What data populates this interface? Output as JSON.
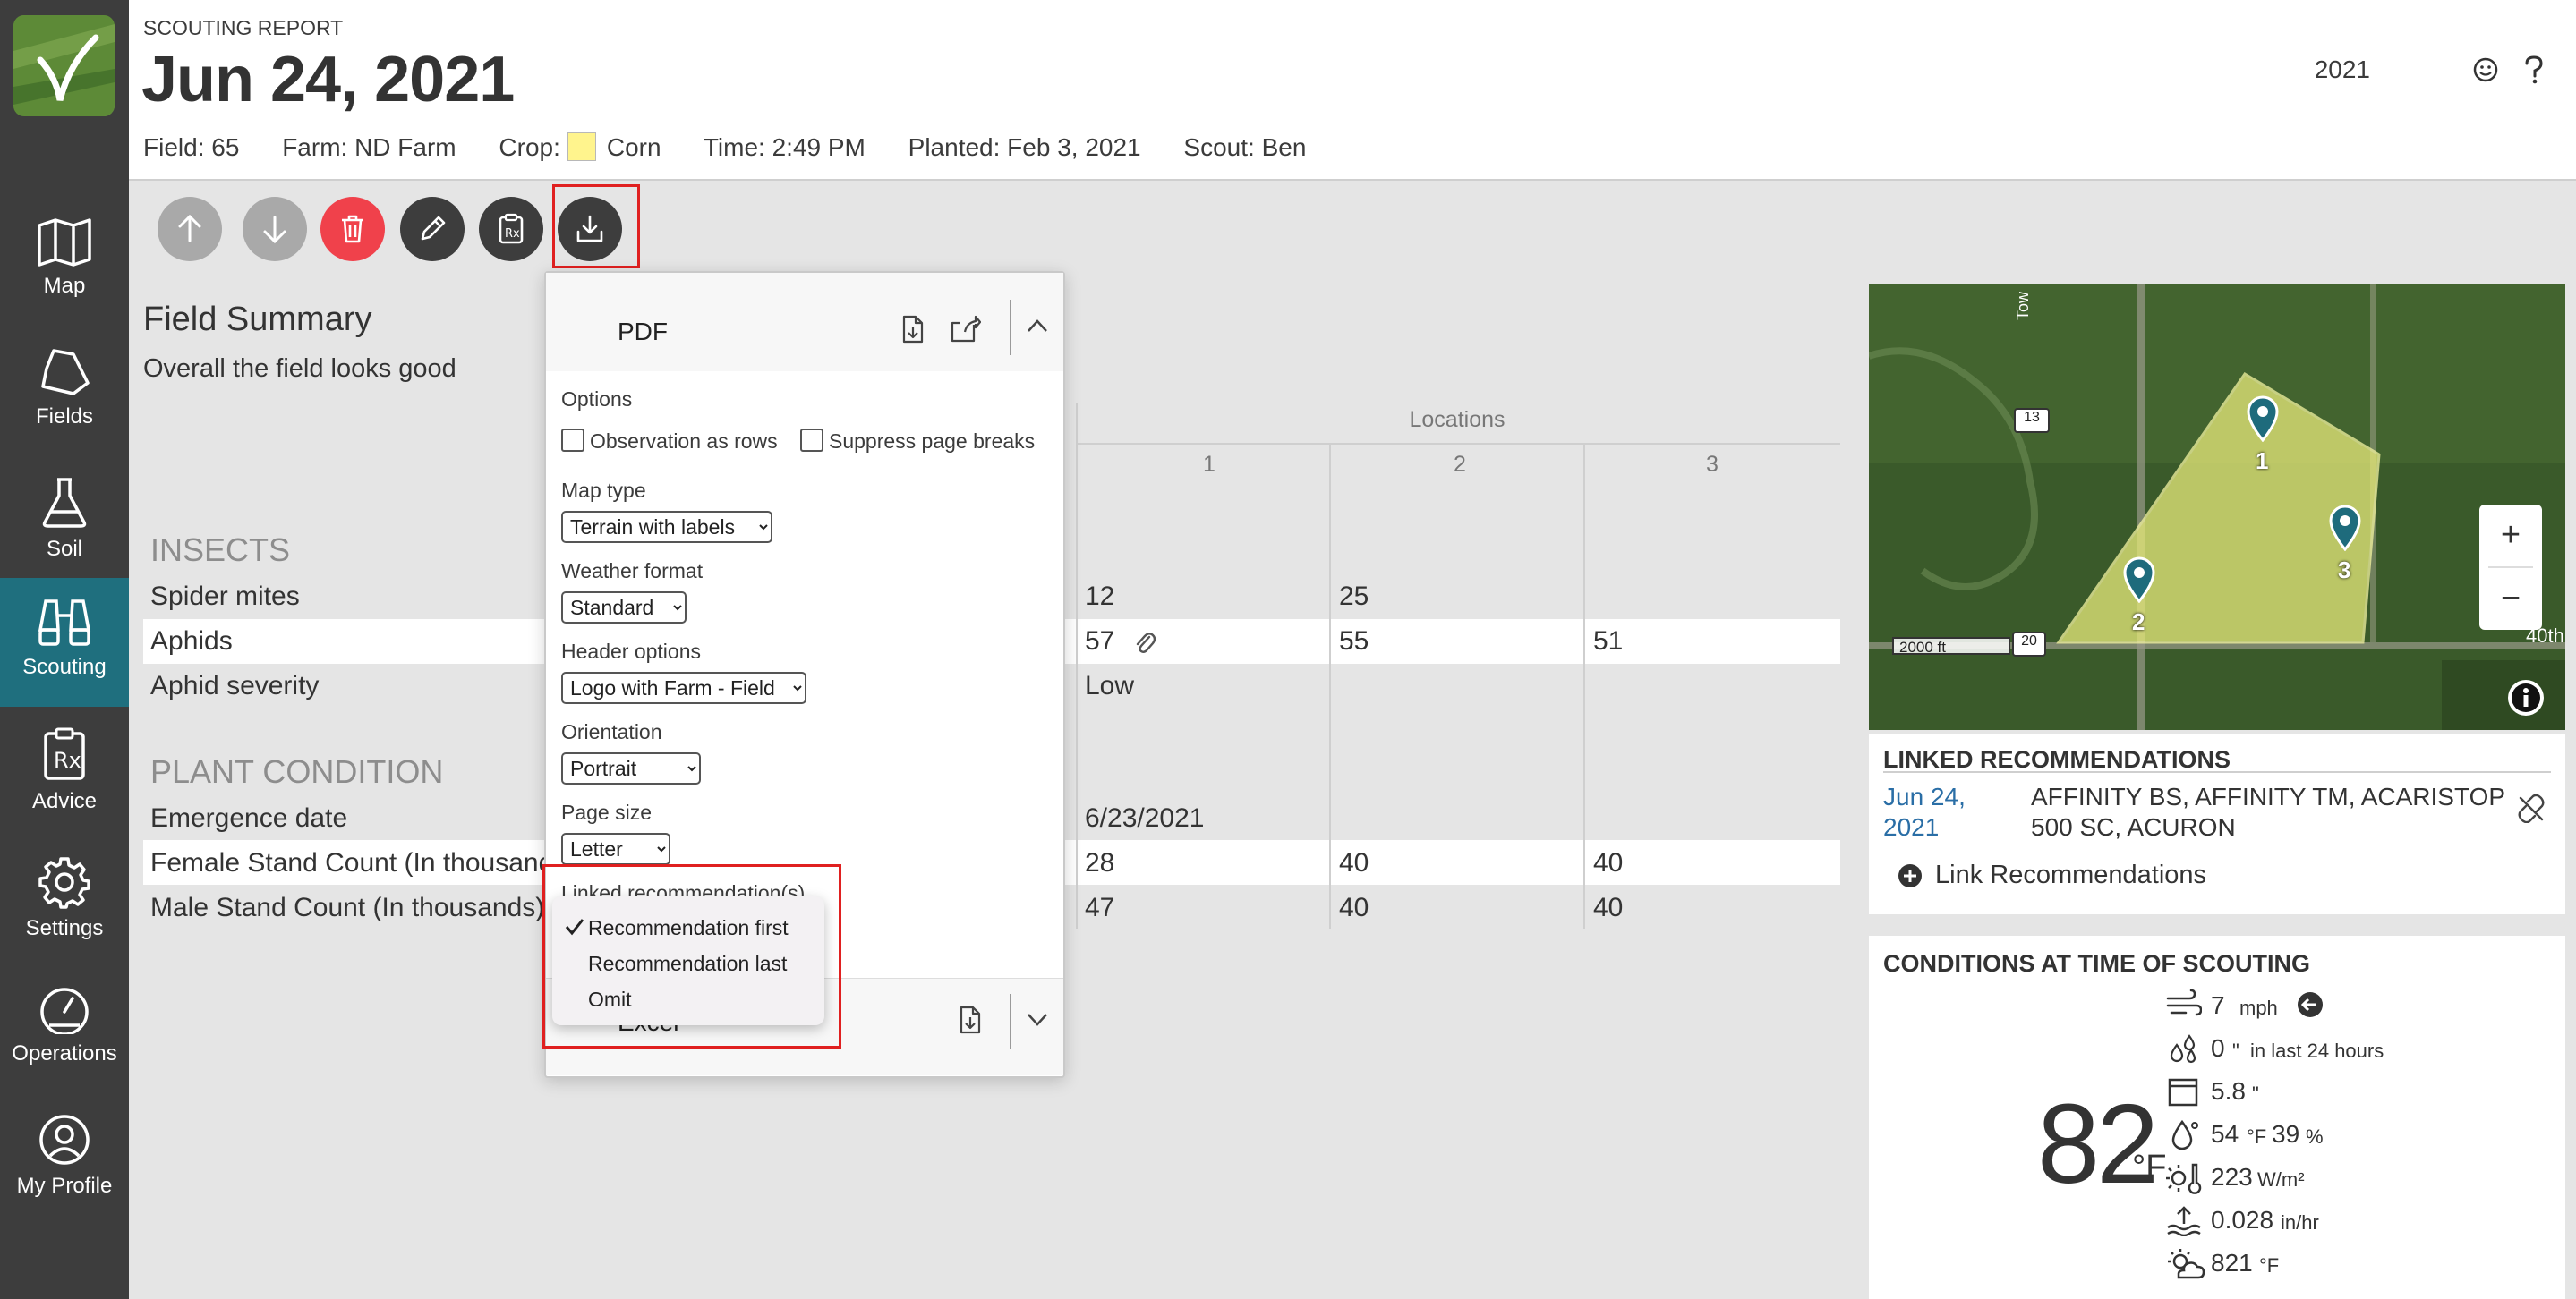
{
  "sidebar": {
    "items": [
      {
        "label": "Map",
        "icon": "map-icon"
      },
      {
        "label": "Fields",
        "icon": "fields-icon"
      },
      {
        "label": "Soil",
        "icon": "flask-icon"
      },
      {
        "label": "Scouting",
        "icon": "binoculars-icon",
        "active": true
      },
      {
        "label": "Advice",
        "icon": "prescription-icon"
      },
      {
        "label": "Settings",
        "icon": "gear-icon"
      },
      {
        "label": "Operations",
        "icon": "gauge-icon"
      },
      {
        "label": "My Profile",
        "icon": "user-icon"
      }
    ]
  },
  "header": {
    "kicker": "SCOUTING REPORT",
    "date": "Jun 24, 2021",
    "year": "2021",
    "field": "Field: 65",
    "farm": "Farm: ND Farm",
    "crop_label": "Crop:",
    "crop": "Corn",
    "crop_color": "#fff48d",
    "time": "Time: 2:49 PM",
    "planted": "Planted: Feb 3, 2021",
    "scout": "Scout: Ben"
  },
  "summary": {
    "title": "Field Summary",
    "text": "Overall the field looks good"
  },
  "table": {
    "locations_header": "Locations",
    "columns": [
      "1",
      "2",
      "3"
    ],
    "groups": [
      {
        "title": "INSECTS",
        "rows": [
          {
            "label": "Spider mites",
            "values": [
              "12",
              "25",
              ""
            ]
          },
          {
            "label": "Aphids",
            "values": [
              "57",
              "55",
              "51"
            ],
            "attachment": true
          },
          {
            "label": "Aphid severity",
            "values": [
              "Low",
              "",
              ""
            ]
          }
        ]
      },
      {
        "title": "PLANT CONDITION",
        "rows": [
          {
            "label": "Emergence date",
            "values": [
              "6/23/2021",
              "",
              ""
            ]
          },
          {
            "label": "Female Stand Count (In thousands)",
            "values": [
              "28",
              "40",
              "40"
            ]
          },
          {
            "label": "Male Stand Count (In thousands)",
            "values": [
              "47",
              "40",
              "40"
            ]
          }
        ]
      }
    ]
  },
  "export": {
    "pdf_title": "PDF",
    "options_label": "Options",
    "obs_rows_label": "Observation as rows",
    "suppress_label": "Suppress page breaks",
    "map_type_label": "Map type",
    "map_type_value": "Terrain with labels",
    "weather_label": "Weather format",
    "weather_value": "Standard",
    "header_label": "Header options",
    "header_value": "Logo with Farm - Field",
    "orientation_label": "Orientation",
    "orientation_value": "Portrait",
    "page_size_label": "Page size",
    "page_size_value": "Letter",
    "linked_label": "Linked recommendation(s)",
    "excel_title": "Excel",
    "menu": {
      "options": [
        "Recommendation first",
        "Recommendation last",
        "Omit"
      ],
      "selected": "Recommendation first"
    }
  },
  "map": {
    "scale": "2000 ft",
    "road_13": "13",
    "road_20": "20",
    "road_right": "40th",
    "road_top": "Tow",
    "pins": [
      "1",
      "2",
      "3"
    ],
    "zoom_in": "+",
    "zoom_out": "−"
  },
  "linked": {
    "title": "LINKED RECOMMENDATIONS",
    "date_line1": "Jun 24,",
    "date_line2": "2021",
    "products_line1": "AFFINITY BS, AFFINITY TM, ACARISTOP",
    "products_line2": "500 SC, ACURON",
    "link_action": "Link Recommendations"
  },
  "conditions": {
    "title": "CONDITIONS AT TIME OF SCOUTING",
    "temp": "82",
    "temp_unit": "°F",
    "wind_value": "7",
    "wind_unit": "mph",
    "rain_value": "0",
    "rain_unit": "\"  in last 24 hours",
    "soil_value": "5.8",
    "soil_unit": "\"",
    "dew_value": "54",
    "dew_unit": "°F",
    "humidity_value": "39",
    "humidity_unit": "%",
    "solar_value": "223",
    "solar_unit": "W/m²",
    "evap_value": "0.028",
    "evap_unit": "in/hr",
    "gdd_value": "821",
    "gdd_unit": "°F"
  }
}
